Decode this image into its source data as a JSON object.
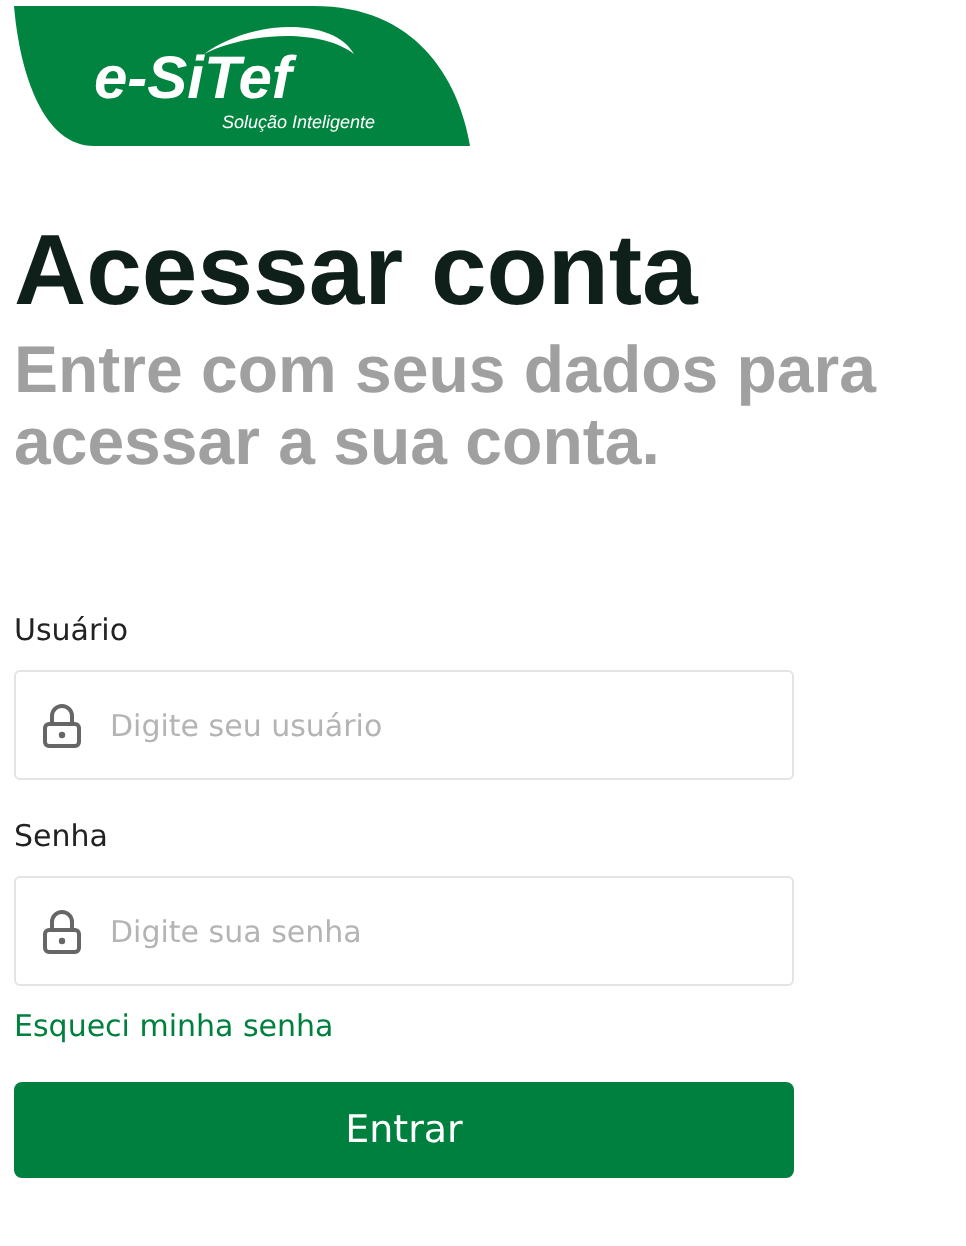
{
  "logo": {
    "name": "e-SiTef",
    "tagline": "Solução Inteligente"
  },
  "title": "Acessar conta",
  "subtitle": "Entre com seus dados para acessar a sua conta.",
  "fields": [
    {
      "label": "Usuário",
      "placeholder": "Digite seu usuário"
    },
    {
      "label": "Senha",
      "placeholder": "Digite sua senha"
    }
  ],
  "forgot_link": "Esqueci minha senha",
  "submit_button": "Entrar"
}
